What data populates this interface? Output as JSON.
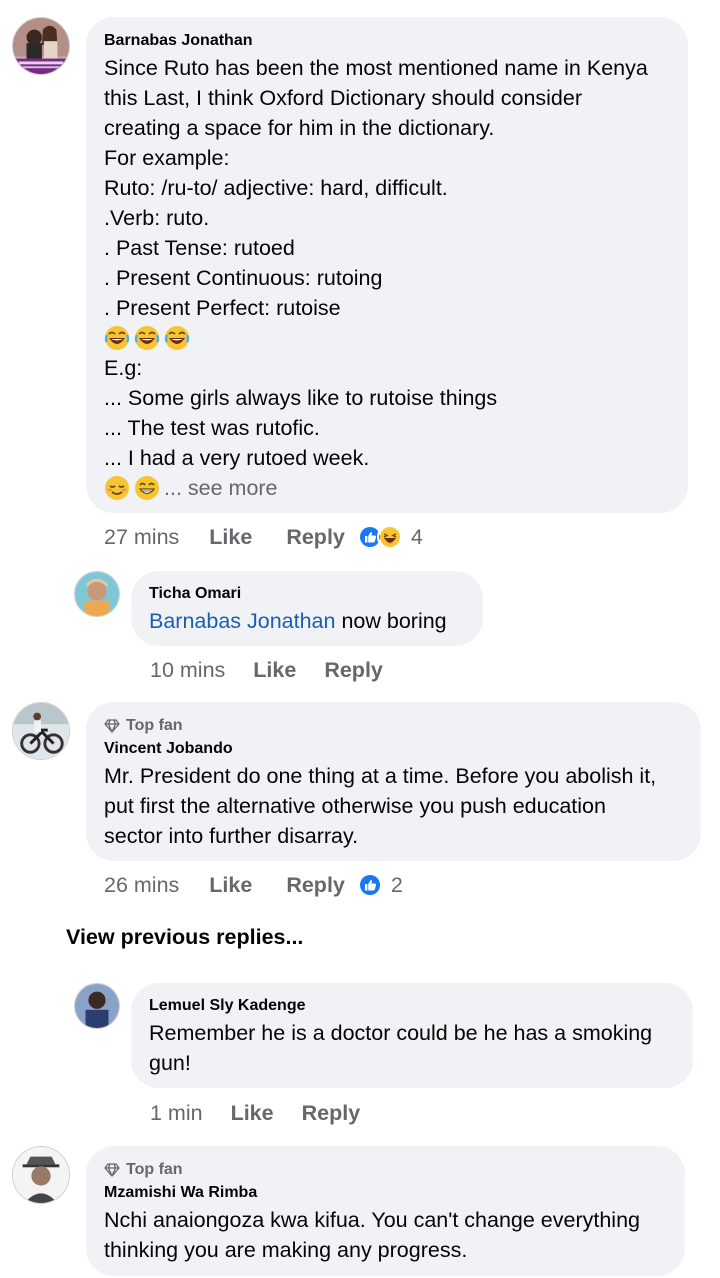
{
  "comments": [
    {
      "author": "Barnabas Jonathan",
      "lines": [
        "Since Ruto has been the most mentioned name in Kenya",
        "this Last, I think Oxford Dictionary should consider",
        "creating a space for him in the dictionary.",
        "For example:",
        "Ruto: /ru-to/ adjective: hard, difficult.",
        ".Verb: ruto.",
        ". Past Tense: rutoed",
        ". Present Continuous: rutoing",
        ". Present Perfect: rutoise",
        "E.g:",
        "... Some girls always like to rutoise things",
        "... The test was rutofic.",
        "... I had a very rutoed week."
      ],
      "see_more": "... see more",
      "time": "27 mins",
      "like": "Like",
      "reply": "Reply",
      "reaction_count": "4",
      "reaction_icons": [
        "like-icon",
        "laugh-icon"
      ]
    },
    {
      "author": "Ticha Omari",
      "mention": "Barnabas Jonathan",
      "text": " now boring",
      "time": "10 mins",
      "like": "Like",
      "reply": "Reply"
    },
    {
      "badge": "Top fan",
      "author": "Vincent Jobando",
      "lines": [
        "Mr. President do one thing at a time. Before you abolish it,",
        "put first the alternative otherwise you push education",
        "sector into further disarray."
      ],
      "time": "26 mins",
      "like": "Like",
      "reply": "Reply",
      "reaction_count": "2",
      "reaction_icons": [
        "like-icon"
      ]
    },
    {
      "author": "Lemuel Sly Kadenge",
      "lines": [
        "Remember he is a doctor could be he has a smoking",
        "gun!"
      ],
      "time": "1 min",
      "like": "Like",
      "reply": "Reply"
    },
    {
      "badge": "Top fan",
      "author": "Mzamishi Wa Rimba",
      "lines": [
        "Nchi anaiongoza kwa kifua. You can't change everything",
        "thinking you are making any progress."
      ]
    }
  ],
  "view_previous": "View previous replies...",
  "colors": {
    "bubble": "#f0f2f5",
    "muted": "#65676b",
    "mention": "#1b5fb2",
    "like_blue": "#1877f2"
  }
}
